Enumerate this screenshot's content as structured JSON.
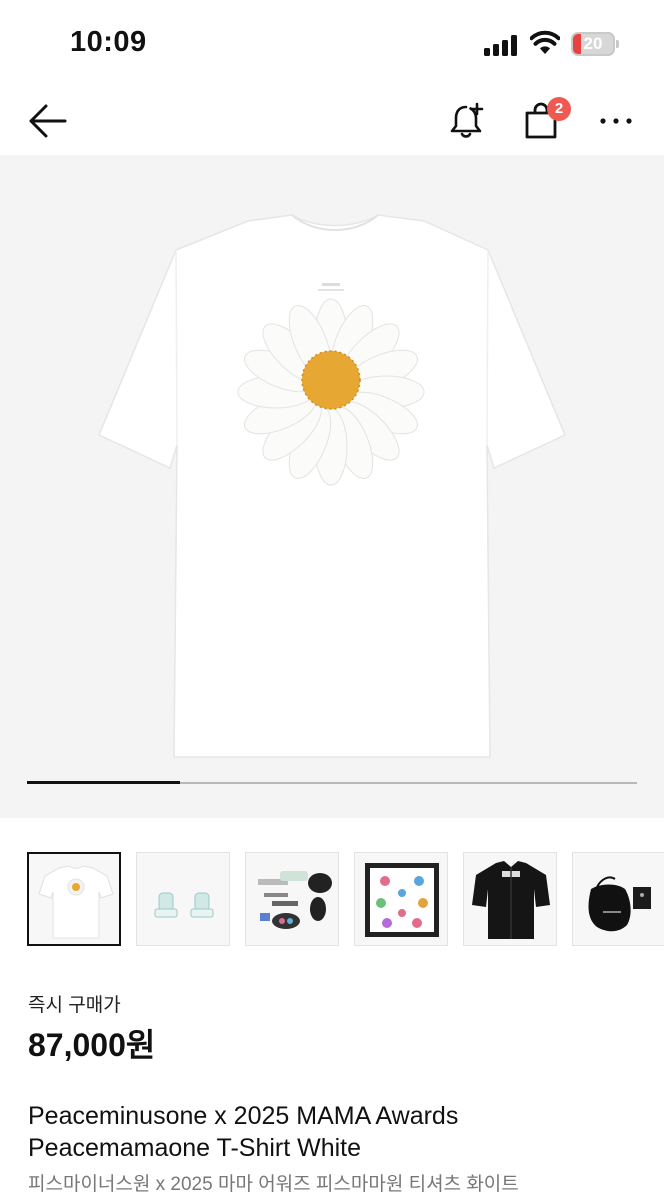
{
  "status_bar": {
    "time": "10:09",
    "battery_level": "20",
    "battery_color": "#e8413f"
  },
  "nav": {
    "back_icon": "arrow-left-icon",
    "bell_icon": "bell-plus-icon",
    "bag_icon": "shopping-bag-icon",
    "bag_badge": "2",
    "badge_color": "#ee5a52",
    "more_icon": "more-horizontal-icon"
  },
  "gallery": {
    "main_image": "white t-shirt with daisy print",
    "progress_fraction": 0.25,
    "thumbnails": [
      {
        "name": "white t-shirt with daisy print",
        "selected": true
      },
      {
        "name": "clip set"
      },
      {
        "name": "sticker set"
      },
      {
        "name": "bandana scarf"
      },
      {
        "name": "black robe"
      },
      {
        "name": "black pouch"
      }
    ]
  },
  "product": {
    "price_label": "즉시 구매가",
    "price": "87,000원",
    "title_en_line1": "Peaceminusone x 2025 MAMA Awards",
    "title_en_line2": "Peacemamaone T-Shirt White",
    "title_ko": "피스마이너스원 x 2025 마마 어워즈 피스마마원 티셔츠 화이트"
  }
}
